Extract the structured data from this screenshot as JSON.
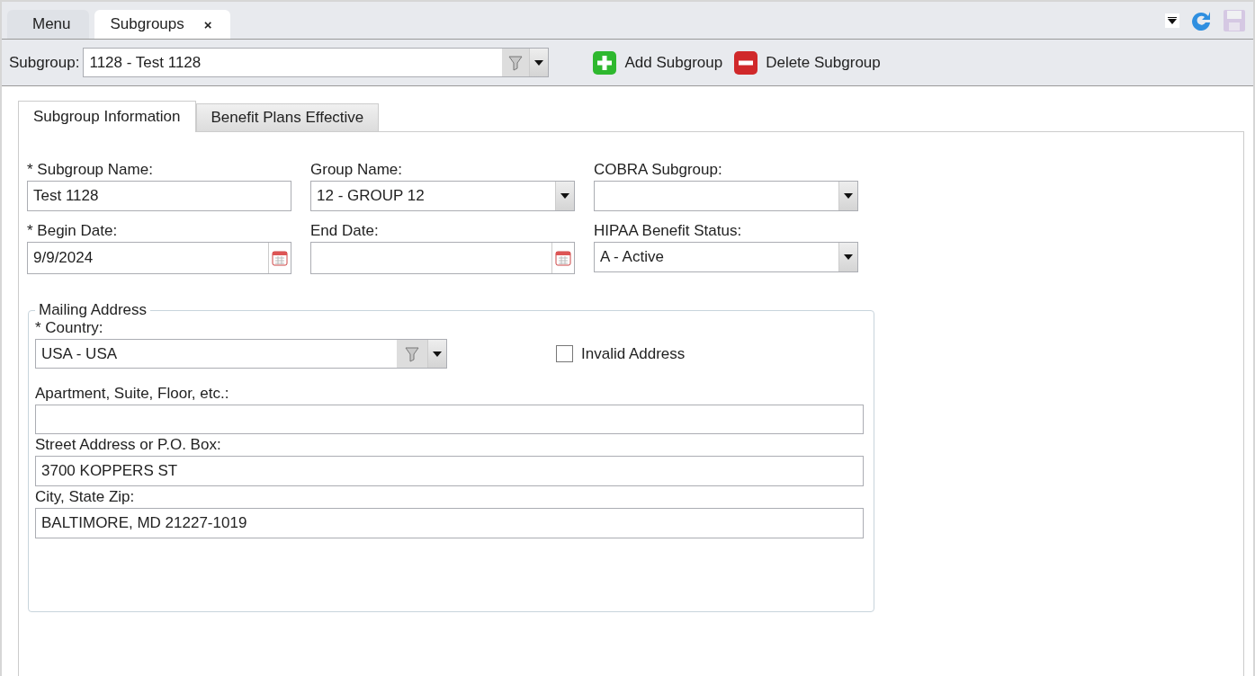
{
  "window_tabs": [
    {
      "label": "Menu",
      "selected": false
    },
    {
      "label": "Subgroups",
      "selected": true,
      "close": "×"
    }
  ],
  "window_actions": {
    "save_disabled": true
  },
  "toolbar": {
    "label": "Subgroup:",
    "value": "1128 - Test 1128",
    "buttons": [
      {
        "kind": "add",
        "label": "Add Subgroup"
      },
      {
        "kind": "delete",
        "label": "Delete Subgroup"
      }
    ]
  },
  "form_tabs": [
    {
      "label": "Subgroup Information",
      "selected": true
    },
    {
      "label": "Benefit Plans Effective",
      "selected": false
    }
  ],
  "fields": [
    {
      "kind": "text",
      "label": "* Subgroup Name:",
      "value": "Test 1128"
    },
    {
      "kind": "dropdown",
      "label": "Group Name:",
      "value": "12 - GROUP 12"
    },
    {
      "kind": "dropdown",
      "label": "COBRA Subgroup:"
    },
    {
      "kind": "date",
      "label": "* Begin Date:",
      "value": "9/9/2024"
    },
    {
      "kind": "date",
      "label": "End Date:"
    },
    {
      "kind": "dropdown",
      "label": "HIPAA Benefit Status:",
      "value": "A - Active"
    }
  ],
  "mailing_address": {
    "title": "Mailing Address",
    "country": {
      "label": "* Country:",
      "value": "USA - USA"
    },
    "invalid_address": {
      "label": "Invalid Address",
      "checked": false
    },
    "fields": [
      {
        "label": "Apartment, Suite, Floor, etc.:"
      },
      {
        "label": "Street Address or P.O. Box:",
        "value": "3700 KOPPERS ST"
      },
      {
        "label": "City, State Zip:",
        "value": "BALTIMORE, MD 21227-1019"
      }
    ]
  }
}
